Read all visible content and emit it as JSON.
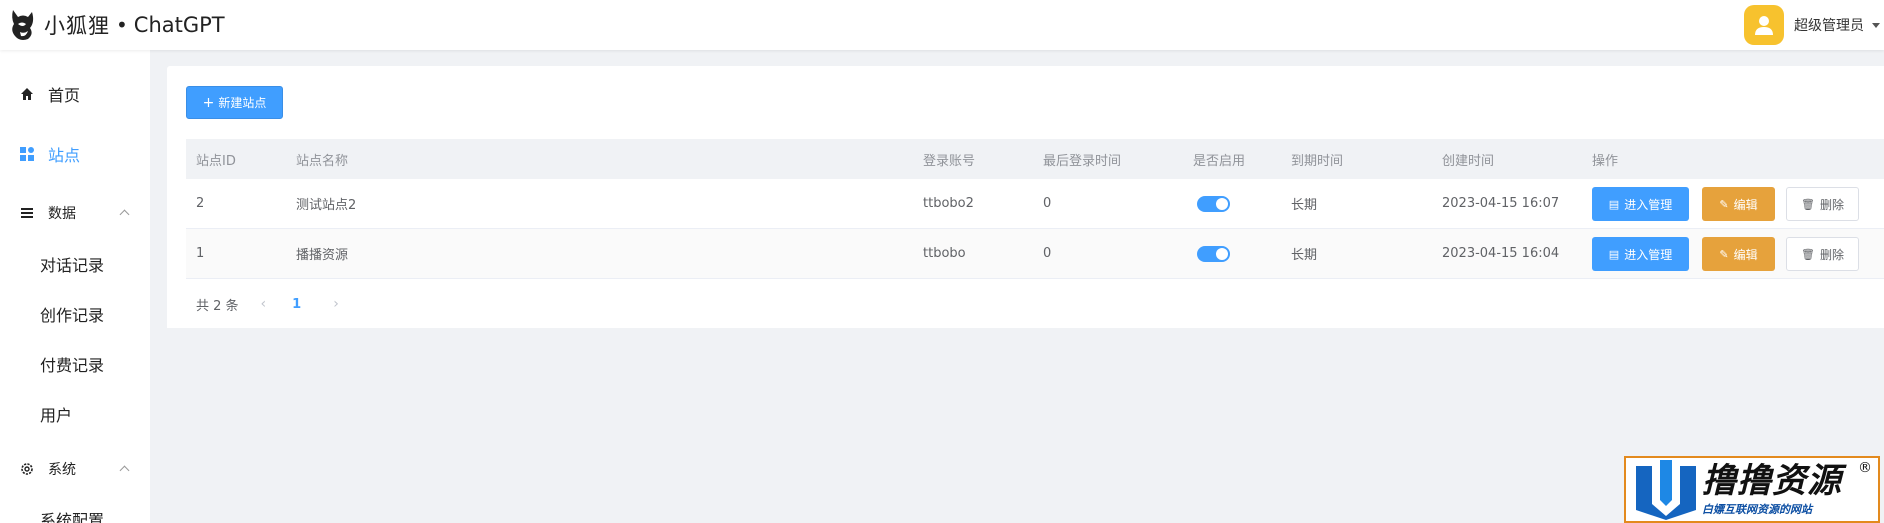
{
  "header": {
    "brand": "小狐狸",
    "brand_sep": "•",
    "brand_product": "ChatGPT",
    "user_name": "超级管理员",
    "avatar_color": "#f7c22e"
  },
  "sidebar": {
    "items": [
      {
        "label": "首页",
        "icon": "home-icon"
      },
      {
        "label": "站点",
        "icon": "grid-icon",
        "active": true
      },
      {
        "label": "数据",
        "icon": "menu-icon",
        "expandable": true
      },
      {
        "label": "对话记录"
      },
      {
        "label": "创作记录"
      },
      {
        "label": "付费记录"
      },
      {
        "label": "用户"
      },
      {
        "label": "系统",
        "icon": "gear-icon",
        "expandable": true
      },
      {
        "label": "系统配置"
      }
    ]
  },
  "toolbar": {
    "new_site_label": "新建站点"
  },
  "table": {
    "columns": [
      "站点ID",
      "站点名称",
      "登录账号",
      "最后登录时间",
      "是否启用",
      "到期时间",
      "创建时间",
      "操作"
    ],
    "rows": [
      {
        "id": "2",
        "name": "测试站点2",
        "account": "ttbobo2",
        "last_login": "0",
        "enabled": true,
        "expire": "长期",
        "created": "2023-04-15 16:07"
      },
      {
        "id": "1",
        "name": "播播资源",
        "account": "ttbobo",
        "last_login": "0",
        "enabled": true,
        "expire": "长期",
        "created": "2023-04-15 16:04"
      }
    ],
    "actions": {
      "manage": "进入管理",
      "edit": "编辑",
      "delete": "删除"
    }
  },
  "pagination": {
    "total_text": "共 2 条",
    "current_page": "1"
  },
  "watermark": {
    "title": "撸撸资源",
    "subtitle": "白嫖互联网资源的网站",
    "reg": "®"
  },
  "colors": {
    "primary": "#409eff",
    "warning": "#e6a23c",
    "background": "#f0f2f5"
  }
}
